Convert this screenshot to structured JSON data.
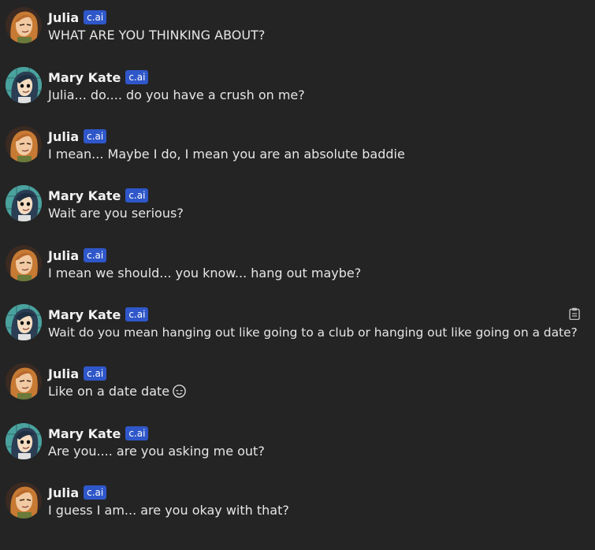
{
  "badge_label": "c.ai",
  "colors": {
    "background": "#242424",
    "badge": "#2f57c9",
    "julia_hair": "#c77a33",
    "mary_kate_hair": "#2b3e54"
  },
  "messages": [
    {
      "speaker": "julia",
      "name": "Julia",
      "text": "WHAT ARE YOU THINKING ABOUT?"
    },
    {
      "speaker": "mary",
      "name": "Mary Kate",
      "text": "Julia... do.... do you have a crush on me?"
    },
    {
      "speaker": "julia",
      "name": "Julia",
      "text": "I mean... Maybe I do, I mean you are an absolute baddie"
    },
    {
      "speaker": "mary",
      "name": "Mary Kate",
      "text": "Wait are you serious?"
    },
    {
      "speaker": "julia",
      "name": "Julia",
      "text": "I mean we should... you know... hang out maybe?"
    },
    {
      "speaker": "mary",
      "name": "Mary Kate",
      "text": "Wait do you mean hanging out like going to a club or hanging out like going on a date?",
      "icon": "clipboard-icon"
    },
    {
      "speaker": "julia",
      "name": "Julia",
      "text": "Like on a date date",
      "icon": "relieved-face-emoji-icon"
    },
    {
      "speaker": "mary",
      "name": "Mary Kate",
      "text": "Are you.... are you asking me out?"
    },
    {
      "speaker": "julia",
      "name": "Julia",
      "text": "I guess I am... are you okay with that?"
    }
  ]
}
